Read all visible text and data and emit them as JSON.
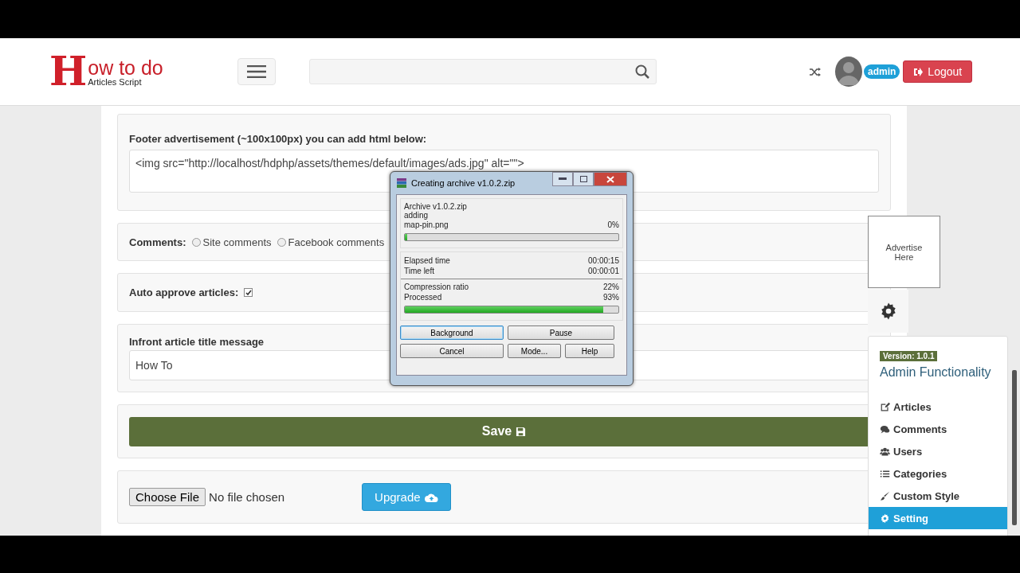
{
  "header": {
    "logo": {
      "letter": "H",
      "title": "ow to do",
      "subtitle": "Articles Script"
    },
    "user": {
      "name": "admin"
    },
    "logout": "Logout"
  },
  "form": [
    {
      "kind": "textarea",
      "label": "Footer advertisement (~100x100px) you can add html below:",
      "value": "<img src=\"http://localhost/hdphp/assets/themes/default/images/ads.jpg\" alt=\"\">"
    },
    {
      "kind": "radios",
      "label": "Comments:",
      "options": [
        {
          "label": "Site comments",
          "selected": false
        },
        {
          "label": "Facebook comments",
          "selected": false
        }
      ]
    },
    {
      "kind": "checkbox",
      "label": "Auto approve articles:",
      "checked": true
    },
    {
      "kind": "text",
      "label": "Infront article title message",
      "value": "How To"
    },
    {
      "kind": "save",
      "label": "Save"
    },
    {
      "kind": "upload",
      "file_button": "Choose File",
      "file_status": "No file chosen",
      "button": "Upgrade"
    }
  ],
  "sidebar": {
    "ad": "Advertise Here",
    "version": "Version: 1.0.1",
    "title": "Admin Functionality",
    "items": [
      {
        "label": "Articles",
        "selected": false
      },
      {
        "label": "Comments",
        "selected": false
      },
      {
        "label": "Users",
        "selected": false
      },
      {
        "label": "Categories",
        "selected": false
      },
      {
        "label": "Custom Style",
        "selected": false
      },
      {
        "label": "Setting",
        "selected": true
      }
    ]
  },
  "dialog": {
    "title": "Creating archive v1.0.2.zip",
    "archive": "Archive v1.0.2.zip",
    "action": "adding",
    "file": "map-pin.png",
    "file_percent": "0%",
    "file_progress": {
      "level": 0
    },
    "stats_a": [
      {
        "label": "Elapsed time",
        "value": "00:00:15"
      },
      {
        "label": "Time left",
        "value": "00:00:01"
      }
    ],
    "stats_b": [
      {
        "label": "Compression ratio",
        "value": "22%"
      },
      {
        "label": "Processed",
        "value": "93%"
      }
    ],
    "total_progress": {
      "level": 0.93
    },
    "buttons": [
      {
        "label": "Background",
        "focused": true
      },
      {
        "label": "Pause",
        "focused": false
      },
      {
        "label": "Cancel",
        "focused": false
      },
      {
        "label": "Mode...",
        "focused": false
      },
      {
        "label": "Help",
        "focused": false
      }
    ]
  }
}
